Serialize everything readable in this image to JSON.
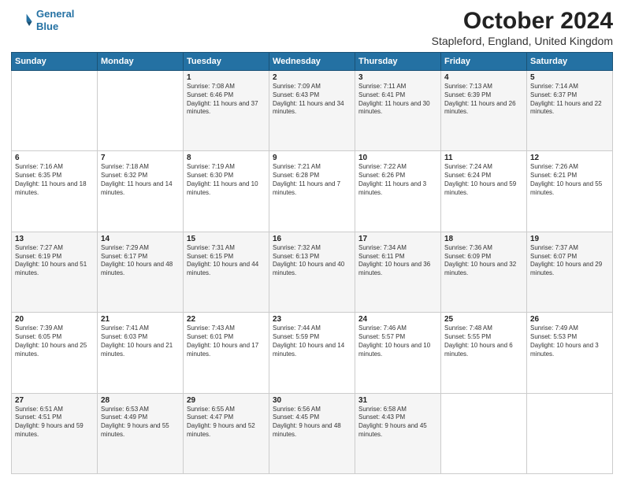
{
  "logo": {
    "line1": "General",
    "line2": "Blue"
  },
  "title": "October 2024",
  "subtitle": "Stapleford, England, United Kingdom",
  "days_of_week": [
    "Sunday",
    "Monday",
    "Tuesday",
    "Wednesday",
    "Thursday",
    "Friday",
    "Saturday"
  ],
  "weeks": [
    [
      {
        "day": "",
        "info": ""
      },
      {
        "day": "",
        "info": ""
      },
      {
        "day": "1",
        "info": "Sunrise: 7:08 AM\nSunset: 6:46 PM\nDaylight: 11 hours and 37 minutes."
      },
      {
        "day": "2",
        "info": "Sunrise: 7:09 AM\nSunset: 6:43 PM\nDaylight: 11 hours and 34 minutes."
      },
      {
        "day": "3",
        "info": "Sunrise: 7:11 AM\nSunset: 6:41 PM\nDaylight: 11 hours and 30 minutes."
      },
      {
        "day": "4",
        "info": "Sunrise: 7:13 AM\nSunset: 6:39 PM\nDaylight: 11 hours and 26 minutes."
      },
      {
        "day": "5",
        "info": "Sunrise: 7:14 AM\nSunset: 6:37 PM\nDaylight: 11 hours and 22 minutes."
      }
    ],
    [
      {
        "day": "6",
        "info": "Sunrise: 7:16 AM\nSunset: 6:35 PM\nDaylight: 11 hours and 18 minutes."
      },
      {
        "day": "7",
        "info": "Sunrise: 7:18 AM\nSunset: 6:32 PM\nDaylight: 11 hours and 14 minutes."
      },
      {
        "day": "8",
        "info": "Sunrise: 7:19 AM\nSunset: 6:30 PM\nDaylight: 11 hours and 10 minutes."
      },
      {
        "day": "9",
        "info": "Sunrise: 7:21 AM\nSunset: 6:28 PM\nDaylight: 11 hours and 7 minutes."
      },
      {
        "day": "10",
        "info": "Sunrise: 7:22 AM\nSunset: 6:26 PM\nDaylight: 11 hours and 3 minutes."
      },
      {
        "day": "11",
        "info": "Sunrise: 7:24 AM\nSunset: 6:24 PM\nDaylight: 10 hours and 59 minutes."
      },
      {
        "day": "12",
        "info": "Sunrise: 7:26 AM\nSunset: 6:21 PM\nDaylight: 10 hours and 55 minutes."
      }
    ],
    [
      {
        "day": "13",
        "info": "Sunrise: 7:27 AM\nSunset: 6:19 PM\nDaylight: 10 hours and 51 minutes."
      },
      {
        "day": "14",
        "info": "Sunrise: 7:29 AM\nSunset: 6:17 PM\nDaylight: 10 hours and 48 minutes."
      },
      {
        "day": "15",
        "info": "Sunrise: 7:31 AM\nSunset: 6:15 PM\nDaylight: 10 hours and 44 minutes."
      },
      {
        "day": "16",
        "info": "Sunrise: 7:32 AM\nSunset: 6:13 PM\nDaylight: 10 hours and 40 minutes."
      },
      {
        "day": "17",
        "info": "Sunrise: 7:34 AM\nSunset: 6:11 PM\nDaylight: 10 hours and 36 minutes."
      },
      {
        "day": "18",
        "info": "Sunrise: 7:36 AM\nSunset: 6:09 PM\nDaylight: 10 hours and 32 minutes."
      },
      {
        "day": "19",
        "info": "Sunrise: 7:37 AM\nSunset: 6:07 PM\nDaylight: 10 hours and 29 minutes."
      }
    ],
    [
      {
        "day": "20",
        "info": "Sunrise: 7:39 AM\nSunset: 6:05 PM\nDaylight: 10 hours and 25 minutes."
      },
      {
        "day": "21",
        "info": "Sunrise: 7:41 AM\nSunset: 6:03 PM\nDaylight: 10 hours and 21 minutes."
      },
      {
        "day": "22",
        "info": "Sunrise: 7:43 AM\nSunset: 6:01 PM\nDaylight: 10 hours and 17 minutes."
      },
      {
        "day": "23",
        "info": "Sunrise: 7:44 AM\nSunset: 5:59 PM\nDaylight: 10 hours and 14 minutes."
      },
      {
        "day": "24",
        "info": "Sunrise: 7:46 AM\nSunset: 5:57 PM\nDaylight: 10 hours and 10 minutes."
      },
      {
        "day": "25",
        "info": "Sunrise: 7:48 AM\nSunset: 5:55 PM\nDaylight: 10 hours and 6 minutes."
      },
      {
        "day": "26",
        "info": "Sunrise: 7:49 AM\nSunset: 5:53 PM\nDaylight: 10 hours and 3 minutes."
      }
    ],
    [
      {
        "day": "27",
        "info": "Sunrise: 6:51 AM\nSunset: 4:51 PM\nDaylight: 9 hours and 59 minutes."
      },
      {
        "day": "28",
        "info": "Sunrise: 6:53 AM\nSunset: 4:49 PM\nDaylight: 9 hours and 55 minutes."
      },
      {
        "day": "29",
        "info": "Sunrise: 6:55 AM\nSunset: 4:47 PM\nDaylight: 9 hours and 52 minutes."
      },
      {
        "day": "30",
        "info": "Sunrise: 6:56 AM\nSunset: 4:45 PM\nDaylight: 9 hours and 48 minutes."
      },
      {
        "day": "31",
        "info": "Sunrise: 6:58 AM\nSunset: 4:43 PM\nDaylight: 9 hours and 45 minutes."
      },
      {
        "day": "",
        "info": ""
      },
      {
        "day": "",
        "info": ""
      }
    ]
  ]
}
